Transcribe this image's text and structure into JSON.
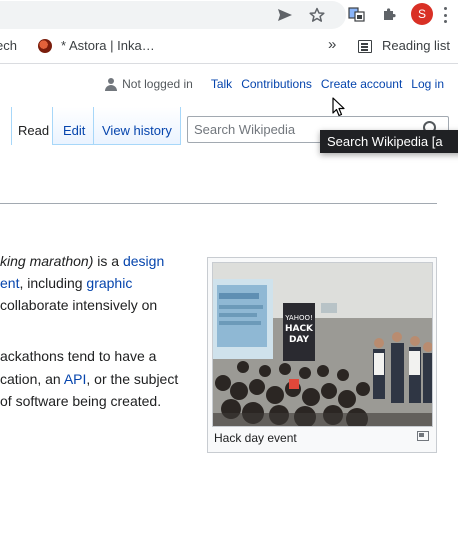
{
  "browser": {
    "toolbar": {
      "icons": [
        "send-icon",
        "star-icon",
        "extension-window-icon",
        "puzzle-icon",
        "profile-avatar",
        "menu-icon"
      ],
      "profile_initial": "S",
      "profile_color": "#d93025"
    },
    "bookmarks": {
      "items": [
        {
          "label": "ech"
        },
        {
          "label": "* Astora | Inka…"
        }
      ],
      "overflow_icon": "double-chevron-icon",
      "reading_list_label": "Reading list"
    }
  },
  "wiki": {
    "personal": {
      "not_logged_in": "Not logged in",
      "links": [
        "Talk",
        "Contributions",
        "Create account",
        "Log in"
      ]
    },
    "tabs": [
      {
        "label": "Read",
        "selected": true
      },
      {
        "label": "Edit",
        "selected": false
      },
      {
        "label": "View history",
        "selected": false
      }
    ],
    "search": {
      "placeholder": "Search Wikipedia",
      "tooltip": "Search Wikipedia [a"
    },
    "body": {
      "line1": {
        "italic_part": "king marathon)",
        "text": " is a ",
        "link": "design"
      },
      "line2": {
        "link1": "ent",
        "text": ", including ",
        "link2": "graphic"
      },
      "line3": {
        "text": "collaborate intensively on"
      },
      "line4": {
        "text": "ackathons tend to have a"
      },
      "line5": {
        "text1": "cation, an ",
        "link": "API",
        "text2": ", or the subject"
      },
      "line6": {
        "text": " of software being created."
      }
    },
    "figure": {
      "caption": "Hack day event",
      "banner_text": [
        "YAHOO!",
        "HACK",
        "DAY"
      ]
    },
    "colors": {
      "link": "#0645ad",
      "text": "#202122",
      "tab_border": "#a7d7f9",
      "tooltip_bg": "#202124"
    }
  }
}
